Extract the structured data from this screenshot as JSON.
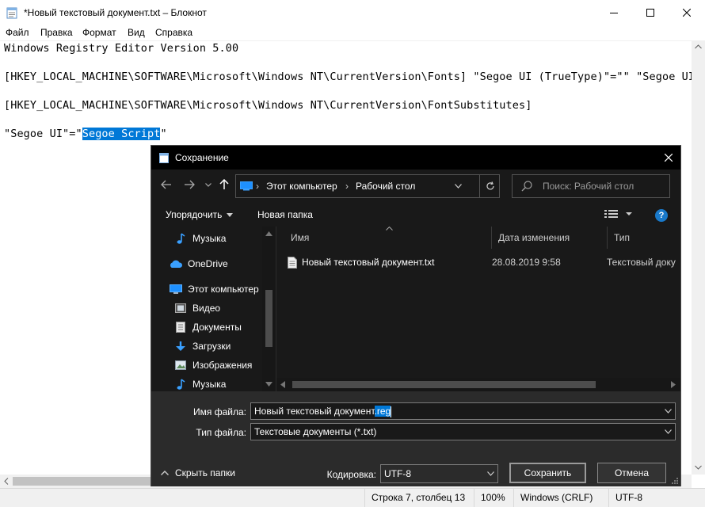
{
  "notepad": {
    "title": "*Новый текстовый документ.txt – Блокнот",
    "menu": [
      "Файл",
      "Правка",
      "Формат",
      "Вид",
      "Справка"
    ],
    "lines": [
      "Windows Registry Editor Version 5.00",
      "[HKEY_LOCAL_MACHINE\\SOFTWARE\\Microsoft\\Windows NT\\CurrentVersion\\Fonts] \"Segoe UI (TrueType)\"=\"\" \"Segoe UI B",
      "[HKEY_LOCAL_MACHINE\\SOFTWARE\\Microsoft\\Windows NT\\CurrentVersion\\FontSubstitutes]"
    ],
    "last_line_prefix": "\"Segoe UI\"=\"",
    "last_line_selected": "Segoe Script",
    "last_line_suffix": "\"",
    "status": {
      "position": "Строка 7, столбец 13",
      "zoom": "100%",
      "line_endings": "Windows (CRLF)",
      "encoding": "UTF-8"
    }
  },
  "dialog": {
    "title": "Сохранение",
    "breadcrumb": [
      "Этот компьютер",
      "Рабочий стол"
    ],
    "search_placeholder": "Поиск: Рабочий стол",
    "toolbar": {
      "organize": "Упорядочить",
      "new_folder": "Новая папка"
    },
    "nav_pane": [
      {
        "label": "Музыка",
        "icon": "music-icon"
      },
      {
        "label": "OneDrive",
        "icon": "cloud-icon"
      },
      {
        "label": "Этот компьютер",
        "icon": "computer-icon"
      },
      {
        "label": "Видео",
        "icon": "video-icon"
      },
      {
        "label": "Документы",
        "icon": "documents-icon"
      },
      {
        "label": "Загрузки",
        "icon": "downloads-icon"
      },
      {
        "label": "Изображения",
        "icon": "pictures-icon"
      },
      {
        "label": "Музыка",
        "icon": "music-icon"
      }
    ],
    "columns": {
      "name": "Имя",
      "date": "Дата изменения",
      "type": "Тип"
    },
    "files": [
      {
        "name": "Новый текстовый документ.txt",
        "date": "28.08.2019 9:58",
        "type": "Текстовый доку"
      }
    ],
    "filename_label": "Имя файла:",
    "filename_base": "Новый текстовый документ",
    "filename_ext_selected": ".reg",
    "filetype_label": "Тип файла:",
    "filetype_value": "Текстовые документы (*.txt)",
    "hide_folders": "Скрыть папки",
    "encoding_label": "Кодировка:",
    "encoding_value": "UTF-8",
    "save_button": "Сохранить",
    "cancel_button": "Отмена"
  }
}
